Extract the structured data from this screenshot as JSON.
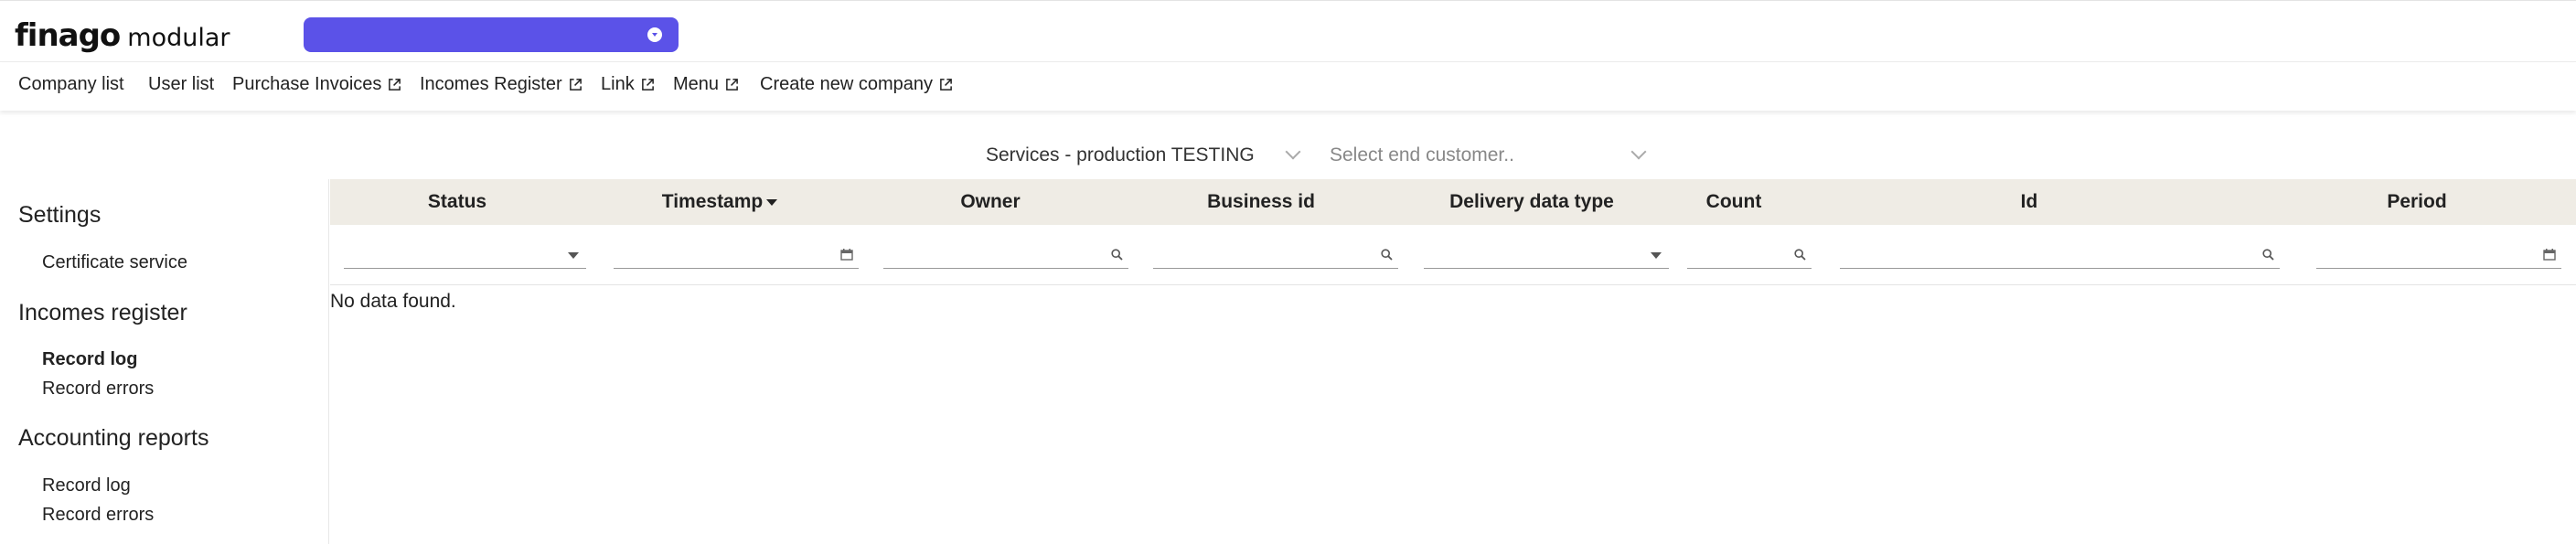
{
  "app": {
    "logo_main": "finago",
    "logo_sub": "modular"
  },
  "nav": {
    "items": [
      {
        "label": "Company list",
        "external": false
      },
      {
        "label": "User list",
        "external": false
      },
      {
        "label": "Purchase Invoices",
        "external": true
      },
      {
        "label": "Incomes Register",
        "external": true
      },
      {
        "label": "Link",
        "external": true
      },
      {
        "label": "Menu",
        "external": true
      },
      {
        "label": "Create new company",
        "external": true
      }
    ]
  },
  "filters": {
    "service": {
      "value": "Services - production TESTING"
    },
    "customer": {
      "placeholder": "Select end customer.."
    }
  },
  "sidebar": {
    "sections": [
      {
        "title": "Settings",
        "links": [
          {
            "label": "Certificate service",
            "active": false
          }
        ]
      },
      {
        "title": "Incomes register",
        "links": [
          {
            "label": "Record log",
            "active": true
          },
          {
            "label": "Record errors",
            "active": false
          }
        ]
      },
      {
        "title": "Accounting reports",
        "links": [
          {
            "label": "Record log",
            "active": false
          },
          {
            "label": "Record errors",
            "active": false
          }
        ]
      }
    ]
  },
  "grid": {
    "columns": [
      {
        "label": "Status",
        "filter": "dropdown",
        "sorted": false
      },
      {
        "label": "Timestamp",
        "filter": "date",
        "sorted": true
      },
      {
        "label": "Owner",
        "filter": "search",
        "sorted": false
      },
      {
        "label": "Business id",
        "filter": "search",
        "sorted": false
      },
      {
        "label": "Delivery data type",
        "filter": "dropdown",
        "sorted": false
      },
      {
        "label": "Count",
        "filter": "search",
        "sorted": false
      },
      {
        "label": "Id",
        "filter": "search",
        "sorted": false
      },
      {
        "label": "Period",
        "filter": "date",
        "sorted": false
      }
    ],
    "empty_text": "No data found."
  },
  "colors": {
    "accent": "#5b52e8",
    "header_bg": "#efece5"
  },
  "icons": {
    "env_select": "chevron-down-circle-icon",
    "external": "external-link-icon",
    "sort": "sort-descending-icon",
    "search": "search-icon",
    "date": "calendar-icon",
    "dropdown": "caret-down-icon"
  }
}
